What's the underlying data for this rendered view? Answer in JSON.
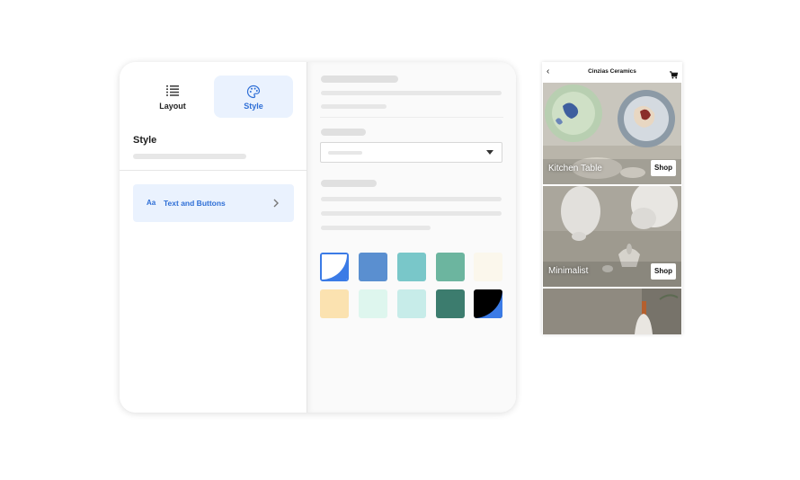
{
  "editor": {
    "tabs": [
      {
        "label": "Layout",
        "icon": "list-icon"
      },
      {
        "label": "Style",
        "icon": "palette-icon",
        "active": true
      }
    ],
    "section_heading": "Style",
    "text_buttons": {
      "icon_text": "Aa",
      "label": "Text and Buttons"
    },
    "swatch_colors": [
      "#ffffff",
      "#5a8fd0",
      "#79c7c9",
      "#6cb59f",
      "#fbf7ec",
      "#fbe2b0",
      "#def6ee",
      "#c7ece9",
      "#3c7c6e",
      "#000000"
    ],
    "accent_color": "#2f6fd6"
  },
  "preview": {
    "store_title": "Cinzias Ceramics",
    "tiles": [
      {
        "name": "Kitchen Table",
        "button": "Shop"
      },
      {
        "name": "Minimalist",
        "button": "Shop"
      }
    ]
  }
}
